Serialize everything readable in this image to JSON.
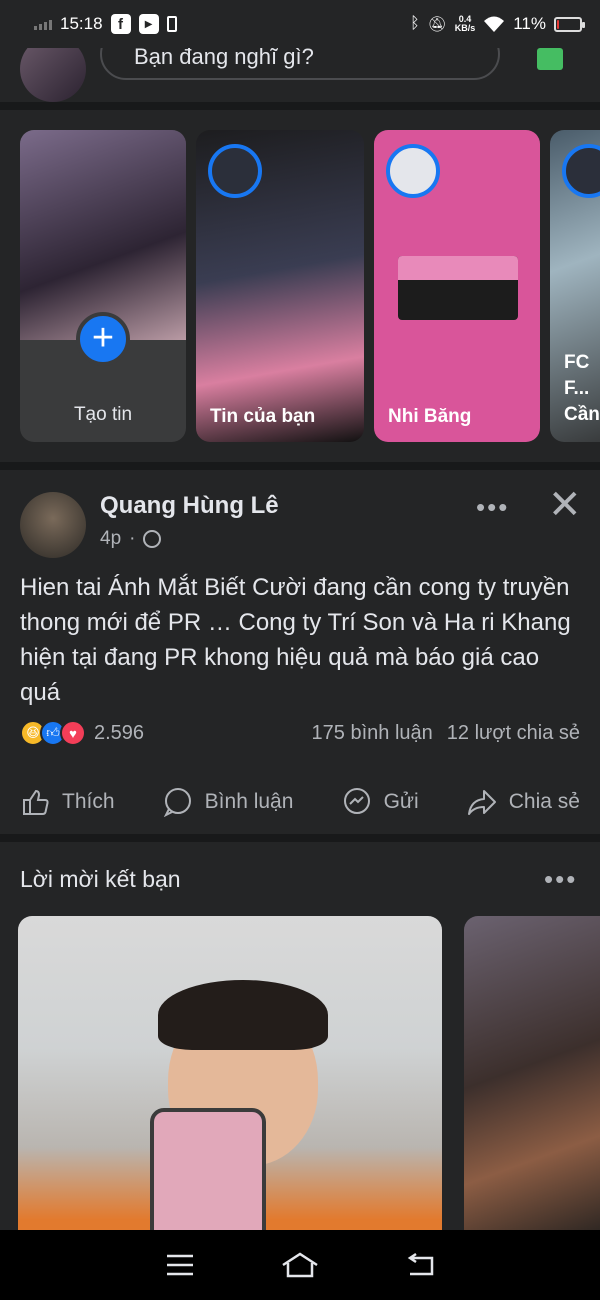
{
  "status_bar": {
    "time": "15:18",
    "net_speed_value": "0.4",
    "net_speed_unit": "KB/s",
    "battery_percent": "11%",
    "battery_level": 0.11
  },
  "composer": {
    "placeholder": "Bạn đang nghĩ gì?"
  },
  "stories": {
    "create_label": "Tạo tin",
    "items": [
      {
        "name": "Tin của bạn"
      },
      {
        "name": "Nhi Băng"
      },
      {
        "name": "FC F... Cần..."
      }
    ]
  },
  "post": {
    "author": "Quang Hùng Lê",
    "time": "4p",
    "text": "Hien tai Ánh Mắt Biết Cười đang cần cong ty truyền thong mới để PR … Cong ty Trí Son và Ha ri Khang hiện tại đang PR khong hiệu quả mà báo giá cao quá",
    "reaction_count": "2.596",
    "comments": "175 bình luận",
    "shares": "12 lượt chia sẻ",
    "actions": {
      "like": "Thích",
      "comment": "Bình luận",
      "send": "Gửi",
      "share": "Chia sẻ"
    }
  },
  "friend_requests": {
    "title": "Lời mời kết bạn"
  },
  "colors": {
    "background": "#242526",
    "separator": "#18191a",
    "accent": "#1877f2",
    "text_primary": "#e4e6eb",
    "text_secondary": "#b0b3b8"
  }
}
